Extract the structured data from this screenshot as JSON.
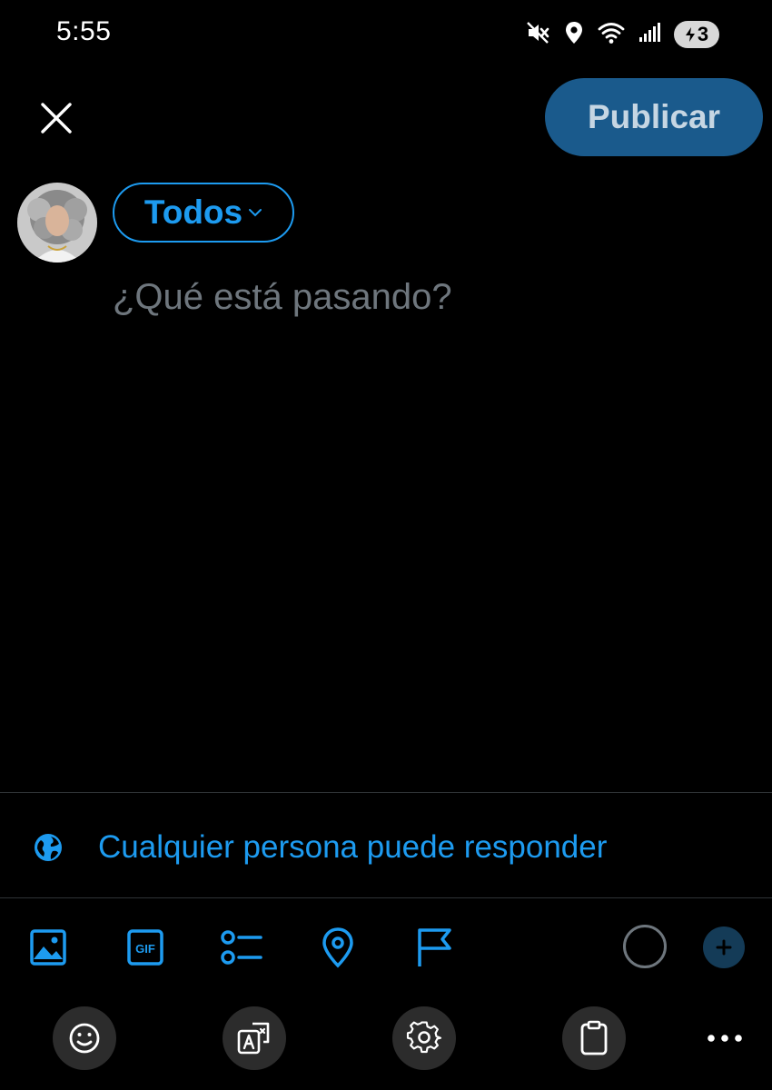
{
  "status_bar": {
    "time": "5:55",
    "battery": "3",
    "icons": [
      "mute-icon",
      "location-icon",
      "wifi-icon",
      "signal-icon",
      "battery-charging-icon"
    ]
  },
  "header": {
    "close_icon": "close-icon",
    "publish_label": "Publicar"
  },
  "composer": {
    "audience_label": "Todos",
    "placeholder": "¿Qué está pasando?",
    "value": ""
  },
  "reply_setting": {
    "icon": "globe-icon",
    "label": "Cualquier persona puede responder"
  },
  "toolbar": {
    "items": [
      "image-icon",
      "gif-icon",
      "poll-icon",
      "location-pin-icon",
      "flag-icon"
    ],
    "gif_label": "GIF"
  },
  "keyboard_bar": {
    "items": [
      "emoji-icon",
      "translate-icon",
      "settings-icon",
      "clipboard-icon",
      "more-icon"
    ]
  },
  "colors": {
    "accent": "#1d9bf0",
    "publish_bg": "#1a5a8c",
    "placeholder": "#6e767d",
    "background": "#000000"
  }
}
